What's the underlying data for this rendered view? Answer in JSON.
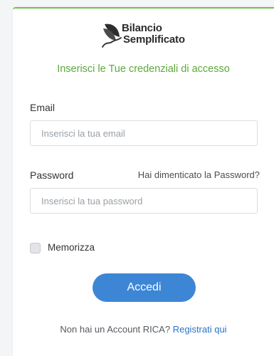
{
  "logo": {
    "line1": "Bilancio",
    "line2": "Semplificato",
    "icon": "leaf-logo-icon"
  },
  "subtitle": "Inserisci le Tue credenziali di accesso",
  "email": {
    "label": "Email",
    "placeholder": "Inserisci la tua email",
    "value": ""
  },
  "password": {
    "label": "Password",
    "placeholder": "Inserisci la tua password",
    "value": "",
    "forgot_label": "Hai dimenticato la Password?"
  },
  "remember": {
    "label": "Memorizza",
    "checked": false
  },
  "login_button": "Accedi",
  "register": {
    "text": "Non hai un Account RICA?",
    "link": "Registrati qui"
  },
  "colors": {
    "accent_green": "#6cc24a",
    "subtitle_green": "#5aa93a",
    "primary_blue": "#3d86d6",
    "link_blue": "#2a73c9"
  }
}
